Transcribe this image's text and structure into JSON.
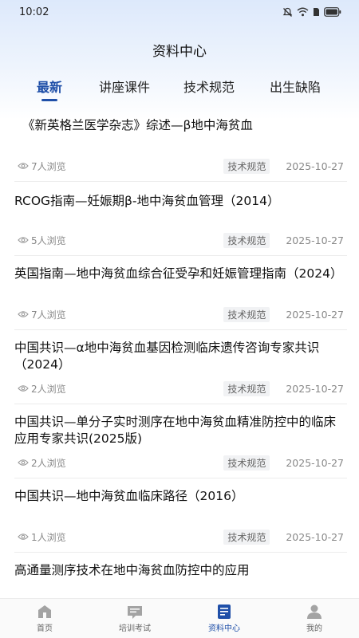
{
  "status_bar": {
    "time": "10:02"
  },
  "page_title": "资料中心",
  "tabs": [
    {
      "label": "最新",
      "active": true
    },
    {
      "label": "讲座课件",
      "active": false
    },
    {
      "label": "技术规范",
      "active": false
    },
    {
      "label": "出生缺陷",
      "active": false
    }
  ],
  "items": [
    {
      "title": "《新英格兰医学杂志》综述—β地中海贫血",
      "views": "7人浏览",
      "tag": "技术规范",
      "date": "2025-10-27"
    },
    {
      "title": "RCOG指南—妊娠期β-地中海贫血管理（2014）",
      "views": "5人浏览",
      "tag": "技术规范",
      "date": "2025-10-27"
    },
    {
      "title": "英国指南—地中海贫血综合征受孕和妊娠管理指南（2024）",
      "views": "7人浏览",
      "tag": "技术规范",
      "date": "2025-10-27"
    },
    {
      "title": "中国共识—α地中海贫血基因检测临床遗传咨询专家共识（2024）",
      "views": "2人浏览",
      "tag": "技术规范",
      "date": "2025-10-27"
    },
    {
      "title": "中国共识—单分子实时测序在地中海贫血精准防控中的临床应用专家共识(2025版)",
      "views": "2人浏览",
      "tag": "技术规范",
      "date": "2025-10-27"
    },
    {
      "title": "中国共识—地中海贫血临床路径（2016）",
      "views": "1人浏览",
      "tag": "技术规范",
      "date": "2025-10-27"
    },
    {
      "title": "高通量测序技术在地中海贫血防控中的应用",
      "views": "",
      "tag": "",
      "date": ""
    }
  ],
  "bottom_nav": [
    {
      "label": "首页",
      "icon": "home-icon",
      "active": false
    },
    {
      "label": "培训考试",
      "icon": "training-icon",
      "active": false
    },
    {
      "label": "资料中心",
      "icon": "document-icon",
      "active": true
    },
    {
      "label": "我的",
      "icon": "profile-icon",
      "active": false
    }
  ],
  "colors": {
    "accent": "#1f4fa8",
    "header_gradient_top": "#dde9fb",
    "meta_text": "#888888",
    "badge_bg": "#f1f2f4"
  }
}
